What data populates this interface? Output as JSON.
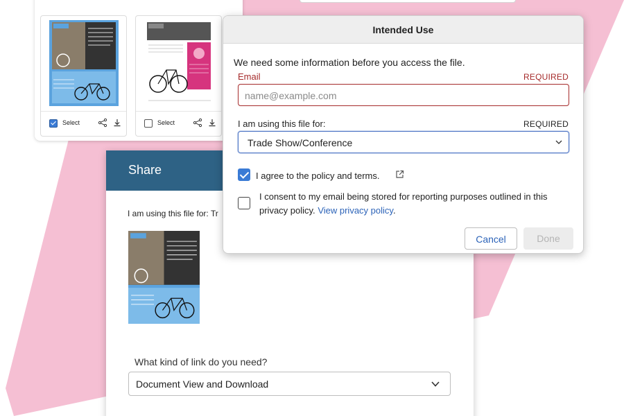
{
  "colors": {
    "pink_accent": "#f5bfd3",
    "share_header": "#2e6285",
    "required_red": "#a52a2a",
    "link_blue": "#2c63b8",
    "checkbox_blue": "#3a7bd5"
  },
  "grid": {
    "tiles": [
      {
        "select_label": "Select",
        "checked": true,
        "icons": [
          "share-icon",
          "download-icon"
        ]
      },
      {
        "select_label": "Select",
        "checked": false,
        "icons": [
          "share-icon",
          "download-icon"
        ]
      }
    ]
  },
  "share": {
    "title": "Share",
    "using_text": "I am using this file for: Tr",
    "link_label": "What kind of link do you need?",
    "link_value": "Document View and Download"
  },
  "modal": {
    "title": "Intended Use",
    "intro": "We need some information before you access the file.",
    "email_label": "Email",
    "required": "REQUIRED",
    "email_placeholder": "name@example.com",
    "using_label": "I am using this file for:",
    "using_value": "Trade Show/Conference",
    "agree_text": "I agree to the policy and terms.",
    "agree_checked": true,
    "consent_text": "I consent to my email being stored for reporting purposes outlined in this privacy policy.",
    "consent_link": "View privacy policy",
    "consent_end": ".",
    "consent_checked": false,
    "cancel_label": "Cancel",
    "done_label": "Done"
  }
}
